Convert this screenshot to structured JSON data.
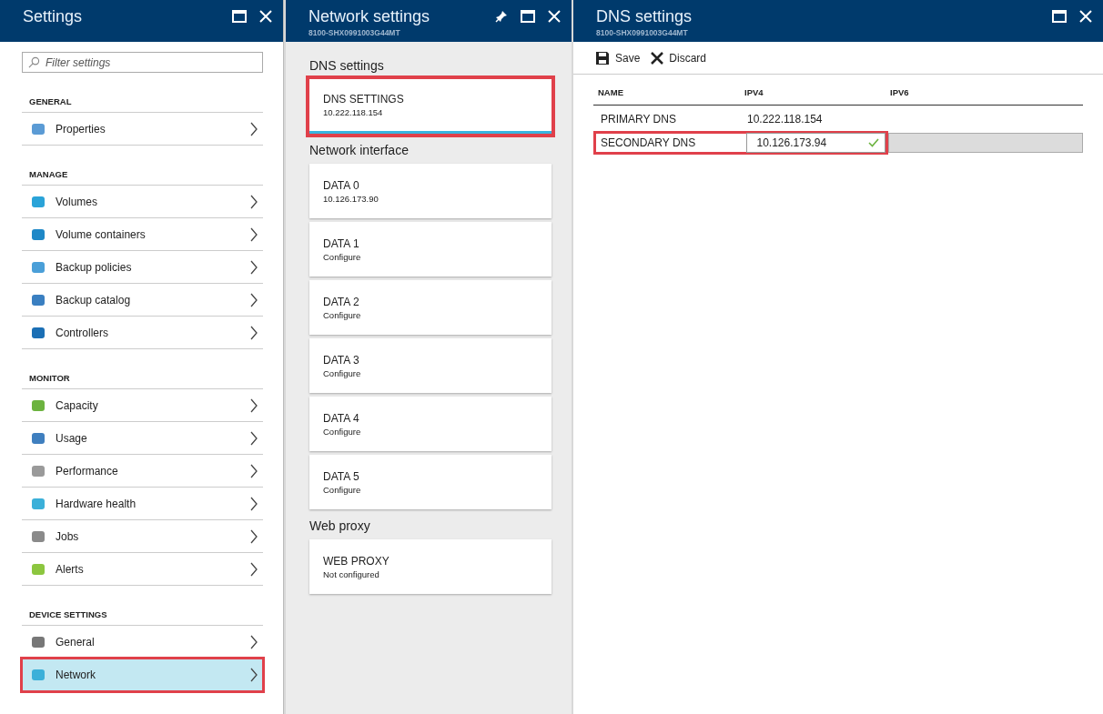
{
  "settings_blade": {
    "title": "Settings",
    "filter": {
      "placeholder": "Filter settings"
    },
    "sections": [
      {
        "label": "GENERAL",
        "items": [
          {
            "label": "Properties",
            "selected": false,
            "highlighted": false
          }
        ]
      },
      {
        "label": "MANAGE",
        "items": [
          {
            "label": "Volumes",
            "selected": false,
            "highlighted": false
          },
          {
            "label": "Volume containers",
            "selected": false,
            "highlighted": false
          },
          {
            "label": "Backup policies",
            "selected": false,
            "highlighted": false
          },
          {
            "label": "Backup catalog",
            "selected": false,
            "highlighted": false
          },
          {
            "label": "Controllers",
            "selected": false,
            "highlighted": false
          }
        ]
      },
      {
        "label": "MONITOR",
        "items": [
          {
            "label": "Capacity",
            "selected": false,
            "highlighted": false
          },
          {
            "label": "Usage",
            "selected": false,
            "highlighted": false
          },
          {
            "label": "Performance",
            "selected": false,
            "highlighted": false
          },
          {
            "label": "Hardware health",
            "selected": false,
            "highlighted": false
          },
          {
            "label": "Jobs",
            "selected": false,
            "highlighted": false
          },
          {
            "label": "Alerts",
            "selected": false,
            "highlighted": false
          }
        ]
      },
      {
        "label": "DEVICE SETTINGS",
        "items": [
          {
            "label": "General",
            "selected": false,
            "highlighted": false
          },
          {
            "label": "Network",
            "selected": true,
            "highlighted": true
          }
        ]
      }
    ]
  },
  "network_blade": {
    "title": "Network settings",
    "subtitle": "8100-SHX0991003G44MT",
    "groups": [
      {
        "label": "DNS settings",
        "cards": [
          {
            "title": "DNS SETTINGS",
            "value": "10.222.118.154",
            "selected": true,
            "highlighted": true
          }
        ]
      },
      {
        "label": "Network interface",
        "cards": [
          {
            "title": "DATA 0",
            "value": "10.126.173.90",
            "selected": false,
            "highlighted": false
          },
          {
            "title": "DATA 1",
            "value": "Configure",
            "selected": false,
            "highlighted": false
          },
          {
            "title": "DATA 2",
            "value": "Configure",
            "selected": false,
            "highlighted": false
          },
          {
            "title": "DATA 3",
            "value": "Configure",
            "selected": false,
            "highlighted": false
          },
          {
            "title": "DATA 4",
            "value": "Configure",
            "selected": false,
            "highlighted": false
          },
          {
            "title": "DATA 5",
            "value": "Configure",
            "selected": false,
            "highlighted": false
          }
        ]
      },
      {
        "label": "Web proxy",
        "cards": [
          {
            "title": "WEB PROXY",
            "value": "Not configured",
            "selected": false,
            "highlighted": false
          }
        ]
      }
    ]
  },
  "dns_blade": {
    "title": "DNS settings",
    "subtitle": "8100-SHX0991003G44MT",
    "toolbar": [
      {
        "kind": "save",
        "label": "Save"
      },
      {
        "kind": "discard",
        "label": "Discard"
      }
    ],
    "table": {
      "columns": [
        "NAME",
        "IPV4",
        "IPV6"
      ],
      "rows": [
        {
          "kind": "static",
          "name": "PRIMARY DNS",
          "ipv4": "10.222.118.154",
          "highlighted": false
        },
        {
          "kind": "edit",
          "name": "SECONDARY DNS",
          "ipv4": "10.126.173.94",
          "highlighted": true
        }
      ]
    }
  }
}
